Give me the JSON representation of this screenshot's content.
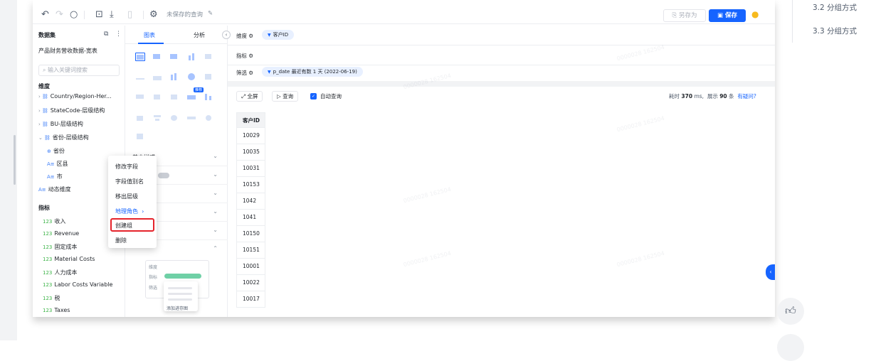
{
  "toolbar": {
    "unsaved_text": "未保存的查询",
    "save_as": "另存为",
    "save": "保存"
  },
  "dataset_panel": {
    "title": "数据集",
    "name": "产品财务营收数据-宽表",
    "search_placeholder": "输入关键词搜索",
    "dimension_label": "维度",
    "dimension_items": [
      "Country/Region-Her...",
      "StateCode-层级结构",
      "BU-层级结构",
      "省份-层级结构",
      "省份",
      "区县",
      "市",
      "动态维度"
    ],
    "measure_label": "指标",
    "measure_items": [
      "收入",
      "Revenue",
      "固定成本",
      "Material Costs",
      "人力成本",
      "Labor Costs Variable",
      "税",
      "Taxes"
    ]
  },
  "chart_panel": {
    "tabs": [
      "图表",
      "分析"
    ],
    "new_badge": "推荐",
    "accordion": [
      "基本样式",
      "",
      "",
      "",
      ""
    ],
    "mini_rows": [
      "维度",
      "指标",
      "筛选"
    ],
    "mini_add": "添加进存图"
  },
  "context_menu": {
    "items": [
      "修改字段",
      "字段值别名",
      "移出层级",
      "地理角色",
      "创建组",
      "删除"
    ]
  },
  "shelves": {
    "dimension_label": "维度",
    "dimension_pill": "客户ID",
    "measure_label": "指标",
    "filter_label": "筛选",
    "filter_pill": "p_date 最近有数 1 天 (2022-06-19)"
  },
  "results": {
    "fullscreen": "全屏",
    "query": "查询",
    "auto_query": "自动查询",
    "time_prefix": "耗时",
    "time_value": "370",
    "time_unit": "ms,",
    "shown_prefix": "展示",
    "shown_value": "90",
    "shown_unit": "条",
    "question": "有疑问?",
    "column_header": "客户ID",
    "rows": [
      "10029",
      "10035",
      "10031",
      "10153",
      "1042",
      "1041",
      "10150",
      "10151",
      "10001",
      "10022",
      "10017"
    ]
  },
  "watermark": "0000028 162504",
  "toc": {
    "items": [
      "3.2 分组方式",
      "3.3 分组方式"
    ]
  }
}
